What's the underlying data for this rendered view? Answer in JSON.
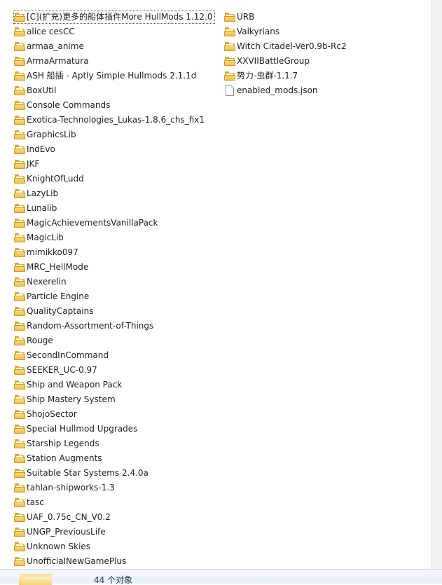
{
  "explorer": {
    "column_1": [
      {
        "name": "[C](扩充)更多的船体插件More HullMods 1.12.0",
        "type": "folder",
        "selected": true
      },
      {
        "name": "alice cesCC",
        "type": "folder"
      },
      {
        "name": "armaa_anime",
        "type": "folder"
      },
      {
        "name": "ArmaArmatura",
        "type": "folder"
      },
      {
        "name": "ASH 船插 - Aptly Simple Hullmods 2.1.1d",
        "type": "folder"
      },
      {
        "name": "BoxUtil",
        "type": "folder"
      },
      {
        "name": "Console Commands",
        "type": "folder"
      },
      {
        "name": "Exotica-Technologies_Lukas-1.8.6_chs_fix1",
        "type": "folder"
      },
      {
        "name": "GraphicsLib",
        "type": "folder"
      },
      {
        "name": "IndEvo",
        "type": "folder"
      },
      {
        "name": "JKF",
        "type": "folder"
      },
      {
        "name": "KnightOfLudd",
        "type": "folder"
      },
      {
        "name": "LazyLib",
        "type": "folder"
      },
      {
        "name": "Lunalib",
        "type": "folder"
      },
      {
        "name": "MagicAchievementsVanillaPack",
        "type": "folder"
      },
      {
        "name": "MagicLib",
        "type": "folder"
      },
      {
        "name": "mimikko097",
        "type": "folder"
      },
      {
        "name": "MRC_HellMode",
        "type": "folder"
      },
      {
        "name": "Nexerelin",
        "type": "folder"
      },
      {
        "name": "Particle Engine",
        "type": "folder"
      },
      {
        "name": "QualityCaptains",
        "type": "folder"
      },
      {
        "name": "Random-Assortment-of-Things",
        "type": "folder"
      },
      {
        "name": "Rouge",
        "type": "folder"
      },
      {
        "name": "SecondInCommand",
        "type": "folder"
      },
      {
        "name": "SEEKER_UC-0.97",
        "type": "folder"
      },
      {
        "name": "Ship and Weapon Pack",
        "type": "folder"
      },
      {
        "name": "Ship Mastery System",
        "type": "folder"
      },
      {
        "name": "ShojoSector",
        "type": "folder"
      },
      {
        "name": "Special Hullmod Upgrades",
        "type": "folder"
      },
      {
        "name": "Starship Legends",
        "type": "folder"
      },
      {
        "name": "Station Augments",
        "type": "folder"
      },
      {
        "name": "Suitable Star Systems 2.4.0a",
        "type": "folder"
      },
      {
        "name": "tahlan-shipworks-1.3",
        "type": "folder"
      },
      {
        "name": "tasc",
        "type": "folder"
      },
      {
        "name": "UAF_0.75c_CN_V0.2",
        "type": "folder"
      },
      {
        "name": "UNGP_PreviousLife",
        "type": "folder"
      },
      {
        "name": "Unknown Skies",
        "type": "folder"
      },
      {
        "name": "UnofficialNewGamePlus",
        "type": "folder"
      }
    ],
    "column_2": [
      {
        "name": "URB",
        "type": "folder"
      },
      {
        "name": "Valkyrians",
        "type": "folder"
      },
      {
        "name": "Witch Citadel-Ver0.9b-Rc2",
        "type": "folder"
      },
      {
        "name": "XXVIIBattleGroup",
        "type": "folder"
      },
      {
        "name": "势力-虫群-1.1.7",
        "type": "folder"
      },
      {
        "name": "enabled_mods.json",
        "type": "file"
      }
    ]
  },
  "details_pane": {
    "object_count": "44 个对象",
    "icon": "folder-icon"
  },
  "colors": {
    "folder": "#efc04e",
    "status_text": "#1e395b",
    "pane_background": "#e7eef8"
  }
}
